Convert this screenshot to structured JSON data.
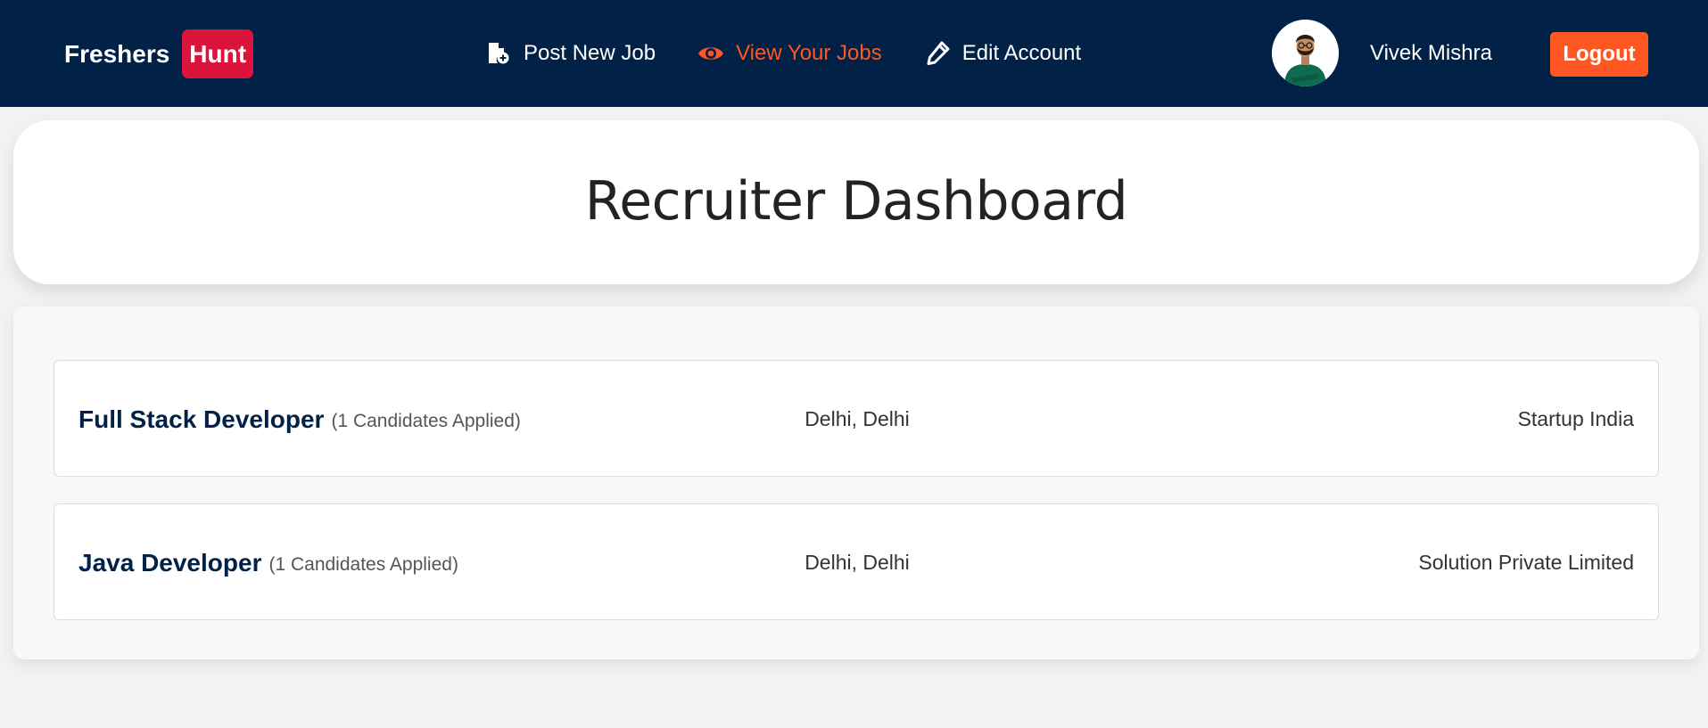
{
  "navbar": {
    "brand_prefix": "Freshers",
    "brand_badge": "Hunt",
    "links": [
      {
        "label": "Post New Job",
        "icon": "file-plus-icon",
        "active": false
      },
      {
        "label": "View Your Jobs",
        "icon": "eye-icon",
        "active": true
      },
      {
        "label": "Edit Account",
        "icon": "pencil-icon",
        "active": false
      }
    ],
    "user_name": "Vivek Mishra",
    "logout_label": "Logout"
  },
  "header": {
    "title": "Recruiter Dashboard"
  },
  "jobs": [
    {
      "title": "Full Stack Developer",
      "candidates": "(1 Candidates Applied)",
      "location": "Delhi, Delhi",
      "company": "Startup India"
    },
    {
      "title": "Java Developer",
      "candidates": "(1 Candidates Applied)",
      "location": "Delhi, Delhi",
      "company": "Solution Private Limited"
    }
  ],
  "colors": {
    "navbar_bg": "#012147",
    "accent": "#ff5722",
    "brand_badge": "#dc143c",
    "page_bg": "#f2f2f2"
  }
}
